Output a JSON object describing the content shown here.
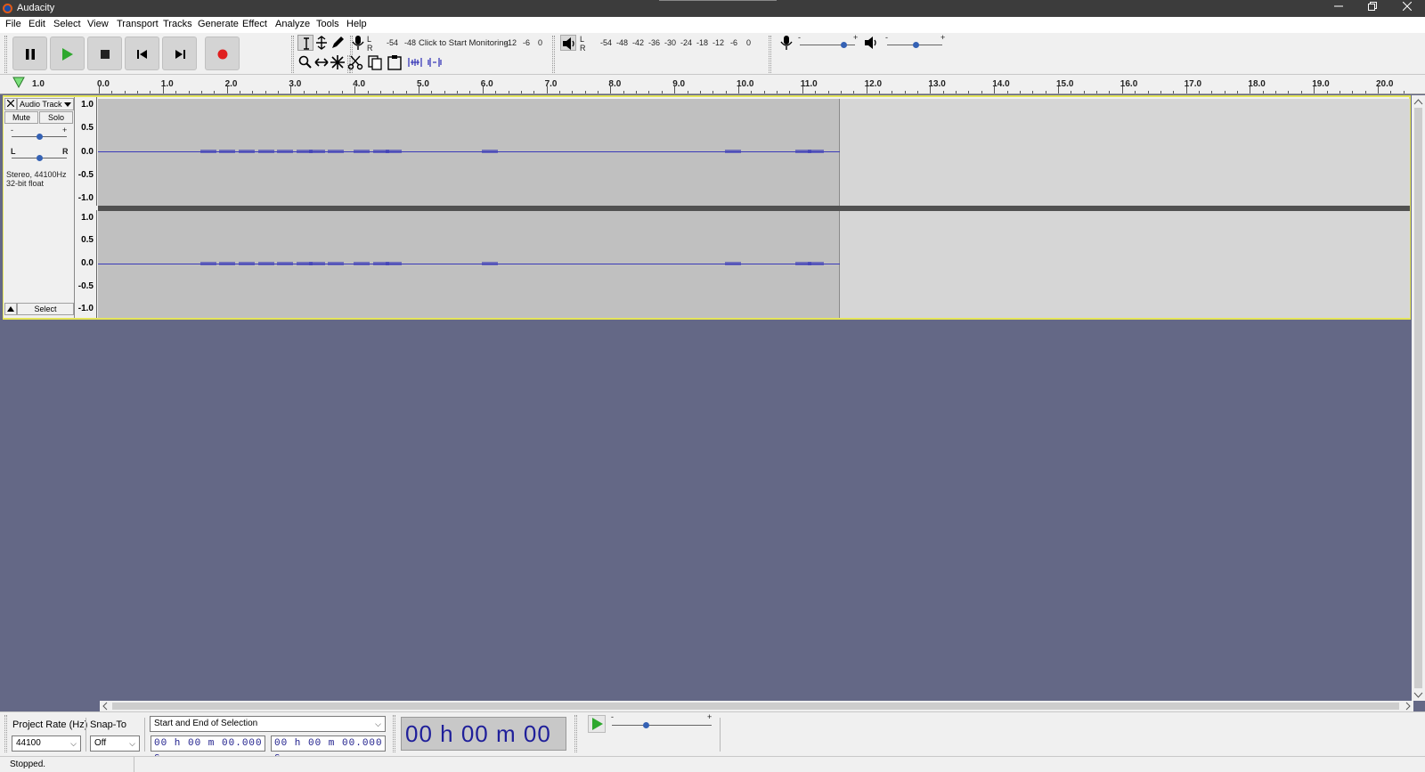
{
  "window": {
    "title": "Audacity",
    "controls": [
      "minimize",
      "restore",
      "close"
    ]
  },
  "menu": [
    "File",
    "Edit",
    "Select",
    "View",
    "Transport",
    "Tracks",
    "Generate",
    "Effect",
    "Analyze",
    "Tools",
    "Help"
  ],
  "transport": {
    "buttons": [
      "pause",
      "play",
      "stop",
      "skip-to-start",
      "skip-to-end",
      "record"
    ],
    "colors": {
      "play": "#2ea82e",
      "record": "#e01e1e",
      "button_bg": "#d4d4d4"
    }
  },
  "tools": [
    "selection-tool",
    "envelope-tool",
    "draw-tool",
    "zoom-tool",
    "time-shift-tool",
    "multi-tool"
  ],
  "edit_tools": [
    "cut",
    "copy",
    "paste",
    "trim-audio",
    "silence-audio"
  ],
  "recording_meter": {
    "channels": [
      "L",
      "R"
    ],
    "scale": [
      "-54",
      "-48",
      "Click to Start Monitoring",
      "-12",
      "-6",
      "0"
    ]
  },
  "playback_meter": {
    "channels": [
      "L",
      "R"
    ],
    "scale": [
      "-54",
      "-48",
      "-42",
      "-36",
      "-30",
      "-24",
      "-18",
      "-12",
      "-6",
      "0"
    ]
  },
  "mixer": {
    "recording_volume_level": 0.8,
    "playback_volume_level": 0.5,
    "minus": "-",
    "plus": "+"
  },
  "timeline": {
    "left_label": "1.0",
    "ticks": [
      "0.0",
      "1.0",
      "2.0",
      "3.0",
      "4.0",
      "5.0",
      "6.0",
      "7.0",
      "8.0",
      "9.0",
      "10.0",
      "11.0",
      "12.0",
      "13.0",
      "14.0",
      "15.0",
      "16.0",
      "17.0",
      "18.0",
      "19.0",
      "20.0"
    ]
  },
  "track": {
    "name": "Audio Track",
    "mute_label": "Mute",
    "solo_label": "Solo",
    "gain_minus": "-",
    "gain_plus": "+",
    "pan_left": "L",
    "pan_right": "R",
    "format_line1": "Stereo, 44100Hz",
    "format_line2": "32-bit float",
    "select_label": "Select",
    "scale_labels": [
      "1.0",
      "0.5",
      "0.0",
      "-0.5",
      "-1.0"
    ],
    "clip_end_seconds": 11.6,
    "waveform_color": "#3a3ab8",
    "selected_border_color": "#e5e55a"
  },
  "selection_toolbar": {
    "project_rate_label": "Project Rate (Hz)",
    "project_rate_value": "44100",
    "snap_to_label": "Snap-To",
    "snap_to_value": "Off",
    "selection_mode": "Start and End of Selection",
    "start_time": "00 h 00 m 00.000 s",
    "end_time": "00 h 00 m 00.000 s",
    "audio_position": "00 h 00 m 00 s"
  },
  "play_at_speed": {
    "minus": "-",
    "plus": "+"
  },
  "status": {
    "text": "Stopped."
  }
}
